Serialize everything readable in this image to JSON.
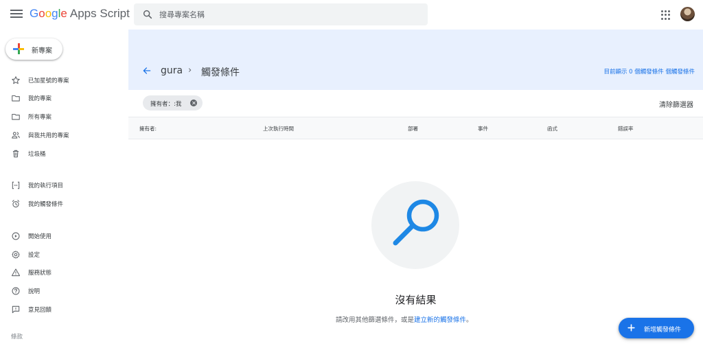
{
  "header": {
    "logo_google": [
      "G",
      "o",
      "o",
      "g",
      "l",
      "e"
    ],
    "logo_product": "Apps Script",
    "search_placeholder": "搜尋專案名稱"
  },
  "sidebar": {
    "new_project_label": "新專案",
    "items": [
      {
        "label": "已加星號的專案",
        "icon": "star-icon"
      },
      {
        "label": "我的專案",
        "icon": "folder-icon"
      },
      {
        "label": "所有專案",
        "icon": "folder-icon"
      },
      {
        "label": "與我共用的專案",
        "icon": "people-icon"
      },
      {
        "label": "垃圾桶",
        "icon": "trash-icon"
      },
      {
        "label": "我的執行項目",
        "icon": "executions-icon"
      },
      {
        "label": "我的觸發條件",
        "icon": "alarm-icon"
      },
      {
        "label": "開始使用",
        "icon": "play-circle-icon"
      },
      {
        "label": "設定",
        "icon": "gear-icon"
      },
      {
        "label": "服務狀態",
        "icon": "warning-icon"
      },
      {
        "label": "說明",
        "icon": "help-icon"
      },
      {
        "label": "意見回饋",
        "icon": "feedback-icon"
      }
    ],
    "terms_label": "條款"
  },
  "page": {
    "project_name": "gura",
    "separator": "›",
    "page_title": "觸發條件",
    "status_text": "目前顯示 0 個觸發條件 個觸發條件"
  },
  "filter": {
    "chip_label": "擁有者：:我",
    "clear_label": "清除篩選器"
  },
  "table": {
    "columns": [
      "擁有者:",
      "上次執行時間",
      "部署",
      "事件",
      "函式",
      "錯誤率"
    ]
  },
  "empty_state": {
    "title": "沒有結果",
    "subtitle_prefix": "請改用其他篩選條件，或是",
    "subtitle_link": "建立新的觸發條件",
    "subtitle_suffix": "。"
  },
  "fab": {
    "label": "新增觸發條件"
  },
  "colors": {
    "accent": "#1a73e8",
    "band": "#e8f0fe",
    "magnifier": "#1e88e5"
  }
}
